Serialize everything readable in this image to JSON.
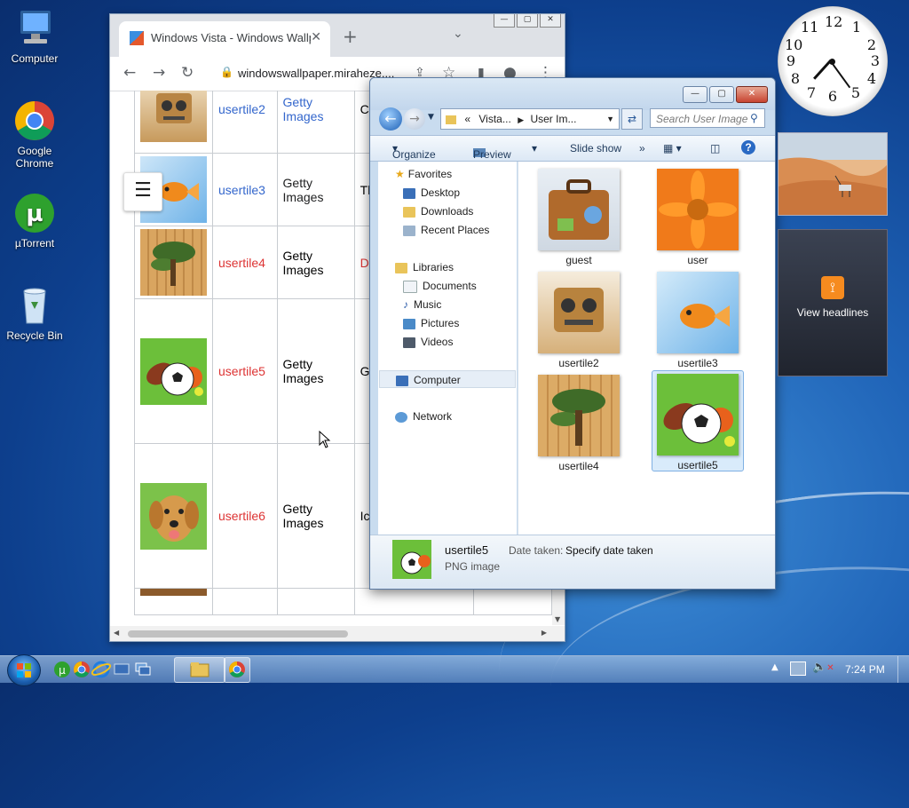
{
  "desktop": {
    "icons": [
      {
        "label": "Computer",
        "icon": "computer-icon"
      },
      {
        "label": "Google\nChrome",
        "icon": "chrome-icon"
      },
      {
        "label": "µTorrent",
        "icon": "utorrent-icon"
      },
      {
        "label": "Recycle Bin",
        "icon": "recycle-bin-icon"
      }
    ]
  },
  "browser": {
    "tab_title": "Windows Vista - Windows Wallp",
    "url": "windowswallpaper.miraheze....",
    "rows": [
      {
        "name": "usertile2",
        "name_color": "#3366cc",
        "source": "Getty Images",
        "source_color": "#3366cc",
        "extra": "C",
        "extra_color": "#202122"
      },
      {
        "name": "usertile3",
        "name_color": "#3366cc",
        "source": "Getty Images",
        "source_color": "#202122",
        "extra": "Th",
        "extra_color": "#202122"
      },
      {
        "name": "usertile4",
        "name_color": "#d33",
        "source": "Getty Images",
        "source_color": "#202122",
        "extra": "DA",
        "extra_color": "#d33"
      },
      {
        "name": "usertile5",
        "name_color": "#d33",
        "source": "Getty Images",
        "source_color": "#202122",
        "extra": "G",
        "extra_color": "#202122"
      },
      {
        "name": "usertile6",
        "name_color": "#d33",
        "source": "Getty Images",
        "source_color": "#202122",
        "extra": "Ic",
        "extra_color": "#202122"
      }
    ]
  },
  "explorer": {
    "address": {
      "prefix": "«",
      "part1": "Vista...",
      "part2": "User Im..."
    },
    "search_placeholder": "Search User Image",
    "toolbar": {
      "organize": "Organize",
      "preview": "Preview",
      "slideshow": "Slide show",
      "more": "»"
    },
    "nav": {
      "favorites": "Favorites",
      "desktop": "Desktop",
      "downloads": "Downloads",
      "recent": "Recent Places",
      "libraries": "Libraries",
      "documents": "Documents",
      "music": "Music",
      "pictures": "Pictures",
      "videos": "Videos",
      "computer": "Computer",
      "network": "Network"
    },
    "files": [
      "guest",
      "user",
      "usertile2",
      "usertile3",
      "usertile4",
      "usertile5"
    ],
    "selected": "usertile5",
    "details": {
      "name": "usertile5",
      "type": "PNG image",
      "date_label": "Date taken:",
      "date_value": "Specify date taken"
    }
  },
  "gadgets": {
    "feed_label": "View headlines"
  },
  "taskbar": {
    "time": "7:24 PM"
  }
}
